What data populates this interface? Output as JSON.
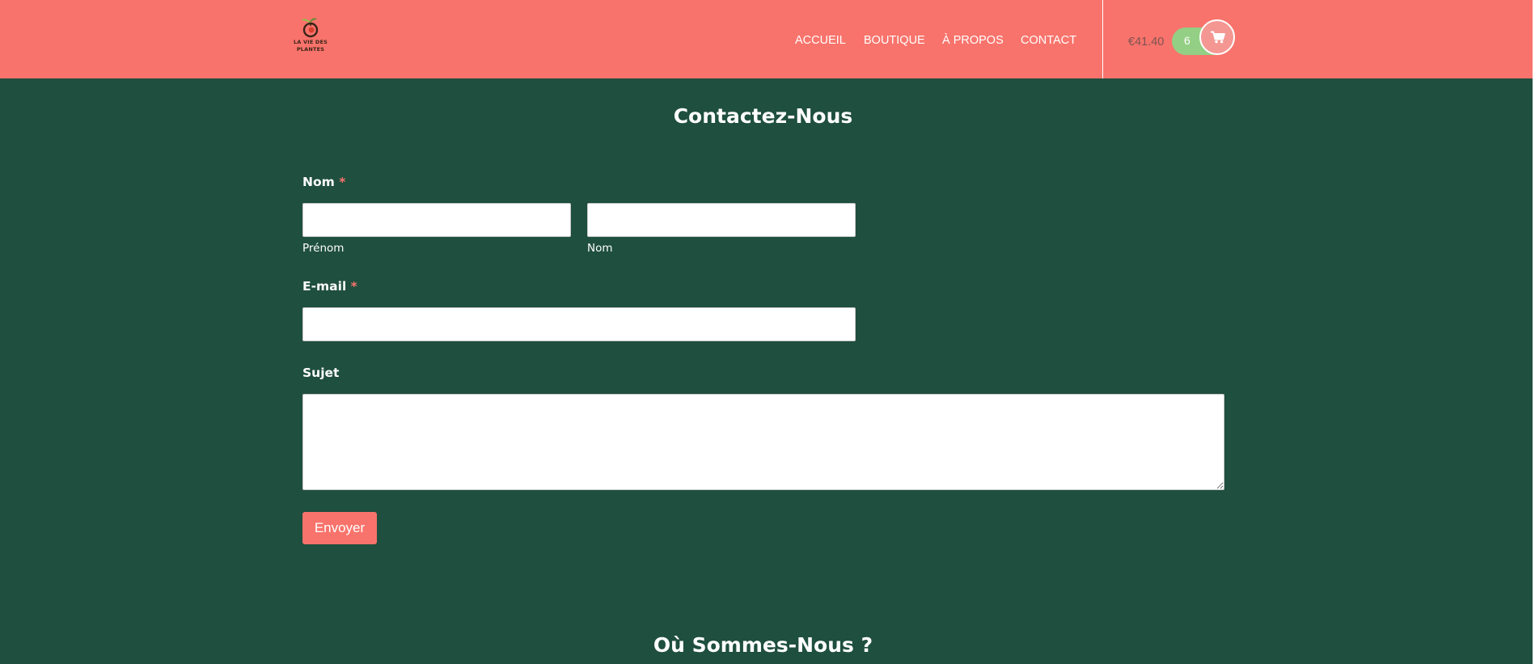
{
  "brand": {
    "logo_text": "LA VIE DES PLANTES",
    "colors": {
      "header": "#f8736b",
      "page": "#1f4f3e",
      "accent": "#f8736b",
      "cart_badge": "#93cf84"
    }
  },
  "nav": {
    "items": [
      {
        "label": "ACCUEIL"
      },
      {
        "label": "BOUTIQUE"
      },
      {
        "label": "À PROPOS"
      },
      {
        "label": "CONTACT"
      }
    ]
  },
  "cart": {
    "total": "€41.40",
    "count": "6",
    "icon": "shopping-cart-icon"
  },
  "contact": {
    "title": "Contactez-Nous",
    "name_label": "Nom",
    "required_marker": "*",
    "first_name_sublabel": "Prénom",
    "last_name_sublabel": "Nom",
    "email_label": "E-mail",
    "subject_label": "Sujet",
    "first_name_value": "",
    "last_name_value": "",
    "email_value": "",
    "subject_value": "",
    "submit_label": "Envoyer"
  },
  "location": {
    "title": "Où Sommes-Nous ?"
  }
}
